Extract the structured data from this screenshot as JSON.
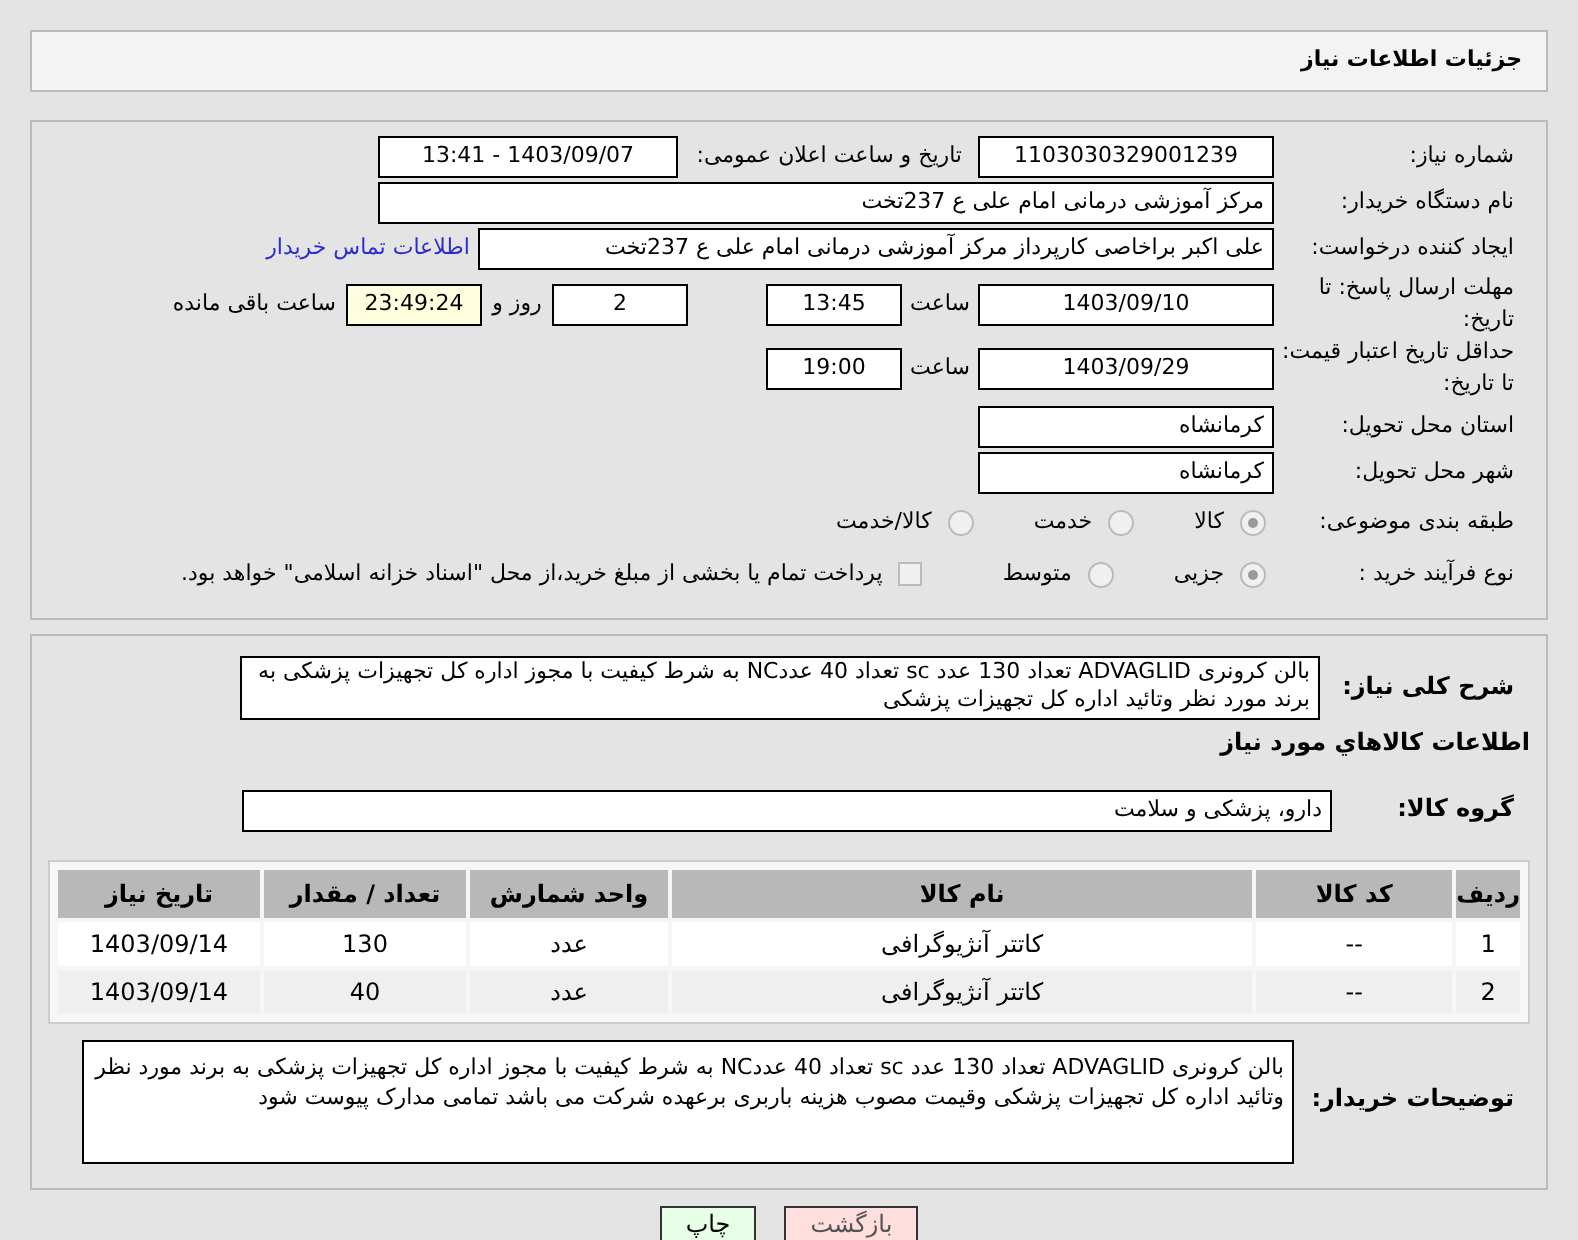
{
  "header": {
    "title": "جزئیات اطلاعات نیاز"
  },
  "need_number": {
    "label": "شماره نیاز:",
    "value": "1103030329001239"
  },
  "announce": {
    "label": "تاریخ و ساعت اعلان عمومی:",
    "value": "1403/09/07 - 13:41"
  },
  "buyer_org": {
    "label": "نام دستگاه خریدار:",
    "value": "مرکز آموزشی درمانی امام علی ع 237تخت"
  },
  "requester": {
    "label": "ایجاد کننده درخواست:",
    "value": "علی اکبر براخاصی کارپرداز  مرکز آموزشی درمانی امام علی ع 237تخت",
    "link": "اطلاعات تماس خریدار"
  },
  "reply_deadline": {
    "label": "مهلت ارسال پاسخ: تا تاریخ:",
    "date": "1403/09/10",
    "time_label": "ساعت",
    "time": "13:45",
    "days": "2",
    "days_label": "روز و",
    "remaining": "23:49:24",
    "remaining_label": "ساعت باقی مانده"
  },
  "price_validity": {
    "label": "حداقل تاریخ اعتبار قیمت: تا تاریخ:",
    "date": "1403/09/29",
    "time_label": "ساعت",
    "time": "19:00"
  },
  "province": {
    "label": "استان محل تحویل:",
    "value": "کرمانشاه"
  },
  "city": {
    "label": "شهر محل تحویل:",
    "value": "کرمانشاه"
  },
  "category": {
    "label": "طبقه بندی موضوعی:",
    "options": [
      {
        "label": "کالا",
        "selected": true
      },
      {
        "label": "خدمت",
        "selected": false
      },
      {
        "label": "کالا/خدمت",
        "selected": false
      }
    ]
  },
  "purchase_type": {
    "label": "نوع فرآیند خرید :",
    "options": [
      {
        "label": "جزیی",
        "selected": true
      },
      {
        "label": "متوسط",
        "selected": false
      }
    ],
    "treasury": {
      "label": "پرداخت تمام یا بخشی از مبلغ خرید،از محل \"اسناد خزانه اسلامی\" خواهد بود.",
      "checked": false
    }
  },
  "description": {
    "label": "شرح کلی نیاز:",
    "value": "بالن کرونری  ADVAGLID تعداد 130 عدد sc  تعداد 40 عددNC   به شرط کیفیت با مجوز اداره کل تجهیزات پزشکی به برند مورد نظر وتائید اداره کل تجهیزات پزشکی"
  },
  "goods_heading": "اطلاعات کالاهاي مورد نياز",
  "goods_group": {
    "label": "گروه کالا:",
    "value": "دارو، پزشکی و سلامت"
  },
  "table": {
    "columns": [
      "ردیف",
      "کد کالا",
      "نام کالا",
      "واحد شمارش",
      "تعداد / مقدار",
      "تاریخ نیاز"
    ],
    "rows": [
      [
        "1",
        "--",
        "کاتتر آنژیوگرافی",
        "عدد",
        "130",
        "1403/09/14"
      ],
      [
        "2",
        "--",
        "کاتتر آنژیوگرافی",
        "عدد",
        "40",
        "1403/09/14"
      ]
    ]
  },
  "buyer_notes": {
    "label": "توضیحات خریدار:",
    "value": "بالن کرونری  ADVAGLID تعداد 130 عدد sc  تعداد 40 عددNC   به شرط کیفیت با مجوز اداره کل تجهیزات پزشکی به برند مورد نظر وتائید اداره کل تجهیزات پزشکی وقیمت مصوب هزینه باربری برعهده شرکت می باشد تمامی مدارک  پیوست شود"
  },
  "buttons": [
    {
      "label": "بازگشت",
      "kind": "back"
    },
    {
      "label": "چاپ",
      "kind": "print"
    }
  ]
}
